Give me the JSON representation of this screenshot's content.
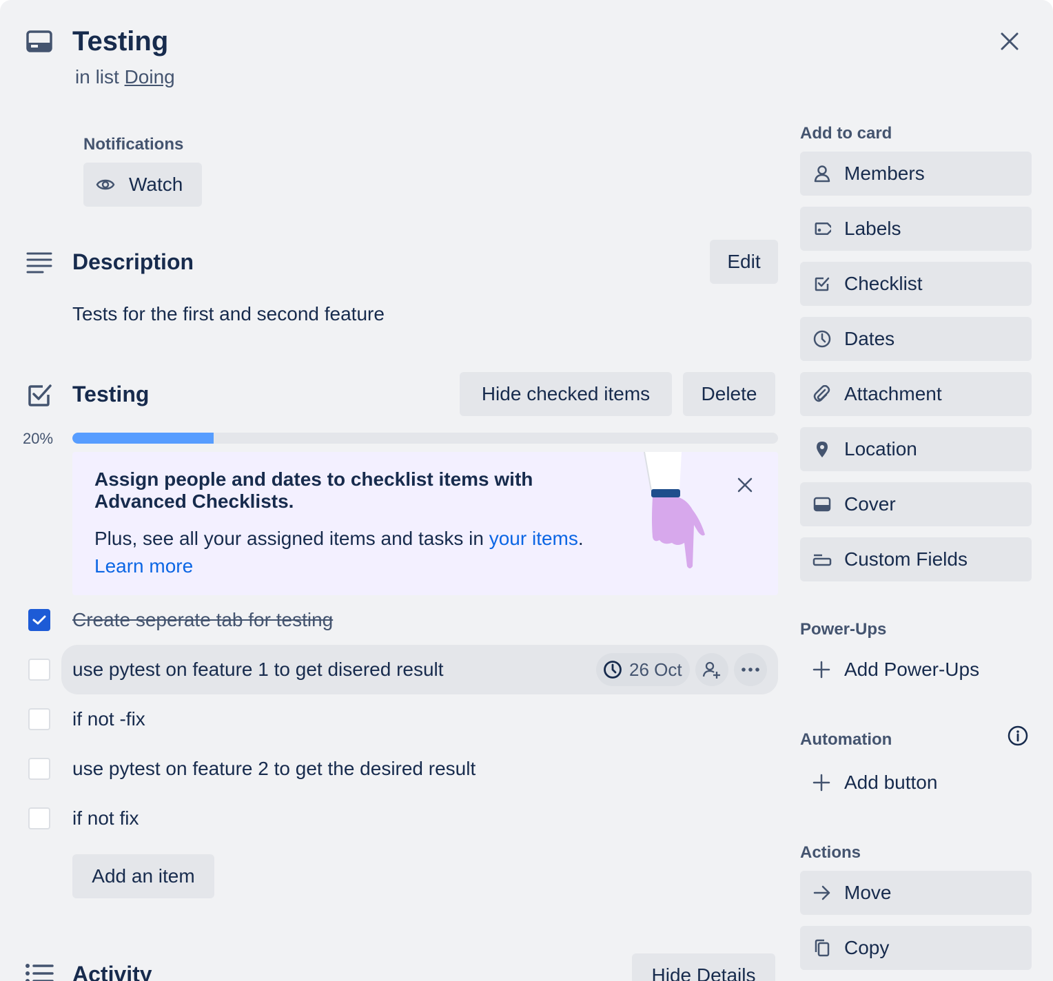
{
  "header": {
    "title": "Testing",
    "in_list_prefix": "in list",
    "list_name": "Doing"
  },
  "notifications": {
    "label": "Notifications",
    "watch_label": "Watch"
  },
  "description": {
    "heading": "Description",
    "edit_label": "Edit",
    "text": "Tests for the first and second feature"
  },
  "checklist": {
    "heading": "Testing",
    "hide_checked_label": "Hide checked items",
    "delete_label": "Delete",
    "progress_text": "20%",
    "progress_value": 0.2,
    "promo": {
      "title": "Assign people and dates to checklist items with Advanced Checklists.",
      "body_prefix": "Plus, see all your assigned items and tasks in",
      "body_link": "your items",
      "body_suffix": ".",
      "learn_more": "Learn more"
    },
    "items": [
      {
        "text": "Create seperate tab for testing",
        "checked": true
      },
      {
        "text": "use pytest on feature 1 to get disered result",
        "checked": false,
        "due": "26 Oct"
      },
      {
        "text": "if not -fix",
        "checked": false
      },
      {
        "text": "use pytest on feature 2 to get the desired result",
        "checked": false
      },
      {
        "text": "if not fix",
        "checked": false
      }
    ],
    "add_item_label": "Add an item"
  },
  "activity": {
    "heading": "Activity",
    "hide_details_label": "Hide Details"
  },
  "sidebar": {
    "add_to_card_label": "Add to card",
    "add_items": [
      {
        "label": "Members",
        "icon": "person-icon"
      },
      {
        "label": "Labels",
        "icon": "tag-icon"
      },
      {
        "label": "Checklist",
        "icon": "checkbox-icon"
      },
      {
        "label": "Dates",
        "icon": "clock-icon"
      },
      {
        "label": "Attachment",
        "icon": "paperclip-icon"
      },
      {
        "label": "Location",
        "icon": "map-pin-icon"
      },
      {
        "label": "Cover",
        "icon": "cover-icon"
      },
      {
        "label": "Custom Fields",
        "icon": "custom-fields-icon"
      }
    ],
    "power_ups_label": "Power-Ups",
    "add_power_ups_label": "Add Power-Ups",
    "automation_label": "Automation",
    "add_button_label": "Add button",
    "actions_label": "Actions",
    "action_items": [
      {
        "label": "Move",
        "icon": "arrow-right-icon"
      },
      {
        "label": "Copy",
        "icon": "copy-icon"
      }
    ]
  },
  "colors": {
    "accent": "#1d5bd6",
    "progress": "#579dff",
    "text": "#172b4d",
    "subtle": "#44546f",
    "button_bg": "#e4e6ea",
    "panel_bg": "#f1f2f4",
    "promo_bg": "#f3f0ff"
  }
}
